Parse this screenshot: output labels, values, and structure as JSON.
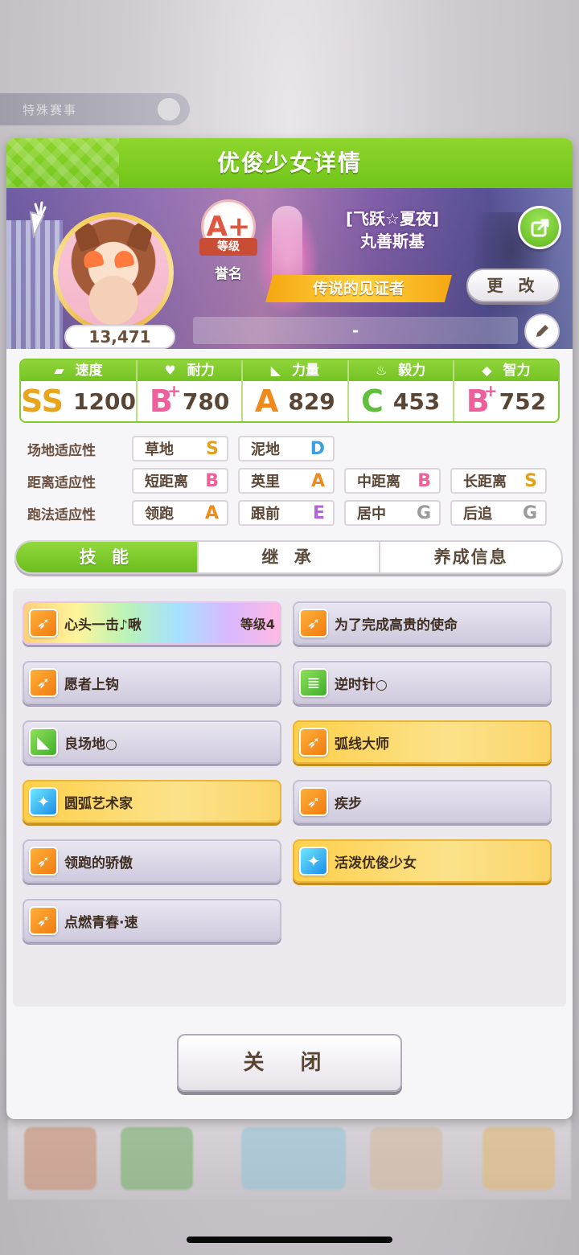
{
  "background": {
    "top_bar_label": "特殊赛事"
  },
  "modal": {
    "title": "优俊少女详情"
  },
  "profile": {
    "score": "13,471",
    "rank": "A+",
    "rank_level_label": "等级",
    "rank_name": "誉名",
    "title_line1": "[飞跃☆夏夜]",
    "title_line2": "丸善斯基",
    "legend_title": "传说的见证者",
    "change_label": "更 改",
    "comment": "-"
  },
  "stats": [
    {
      "label": "速度",
      "icon": "shoe-icon",
      "grade": "SS",
      "plus": "",
      "value": "1200",
      "color": "#e8a41a"
    },
    {
      "label": "耐力",
      "icon": "heart-icon",
      "grade": "B",
      "plus": "+",
      "value": "780",
      "color": "#ee5f9c"
    },
    {
      "label": "力量",
      "icon": "muscle-icon",
      "grade": "A",
      "plus": "",
      "value": "829",
      "color": "#f08a1c"
    },
    {
      "label": "毅力",
      "icon": "flame-icon",
      "grade": "C",
      "plus": "",
      "value": "453",
      "color": "#5fbf3a"
    },
    {
      "label": "智力",
      "icon": "graduation-cap-icon",
      "grade": "B",
      "plus": "+",
      "value": "752",
      "color": "#ee5f9c"
    }
  ],
  "aptitude": {
    "track": {
      "label": "场地适应性",
      "items": [
        {
          "name": "草地",
          "grade": "S",
          "color": "#e3a019"
        },
        {
          "name": "泥地",
          "grade": "D",
          "color": "#3aa0e0"
        }
      ]
    },
    "distance": {
      "label": "距离适应性",
      "items": [
        {
          "name": "短距离",
          "grade": "B",
          "color": "#ee5f9c"
        },
        {
          "name": "英里",
          "grade": "A",
          "color": "#f08a1c"
        },
        {
          "name": "中距离",
          "grade": "B",
          "color": "#ee5f9c"
        },
        {
          "name": "长距离",
          "grade": "S",
          "color": "#e3a019"
        }
      ]
    },
    "strategy": {
      "label": "跑法适应性",
      "items": [
        {
          "name": "领跑",
          "grade": "A",
          "color": "#f08a1c"
        },
        {
          "name": "跟前",
          "grade": "E",
          "color": "#b565d9"
        },
        {
          "name": "居中",
          "grade": "G",
          "color": "#9a9a9a"
        },
        {
          "name": "后追",
          "grade": "G",
          "color": "#9a9a9a"
        }
      ]
    }
  },
  "tabs": [
    "技 能",
    "继 承",
    "养成信息"
  ],
  "skills": [
    {
      "name": "心头一击♪啾",
      "level": "等级4",
      "style": "rainbow",
      "icon": "speed-runner-icon",
      "icon_color": "orange"
    },
    {
      "name": "为了完成高贵的使命",
      "level": "",
      "style": "normal",
      "icon": "speed-runner-icon",
      "icon_color": "orange"
    },
    {
      "name": "愿者上钩",
      "level": "",
      "style": "normal",
      "icon": "speed-runner-icon",
      "icon_color": "orange"
    },
    {
      "name": "逆时针○",
      "level": "",
      "style": "normal",
      "icon": "document-icon",
      "icon_color": "green"
    },
    {
      "name": "良场地○",
      "level": "",
      "style": "normal",
      "icon": "muscle-icon",
      "icon_color": "green"
    },
    {
      "name": "弧线大师",
      "level": "",
      "style": "gold",
      "icon": "speed-runner-icon",
      "icon_color": "orange"
    },
    {
      "name": "圆弧艺术家",
      "level": "",
      "style": "gold",
      "icon": "sparkle-icon",
      "icon_color": "blue"
    },
    {
      "name": "疾步",
      "level": "",
      "style": "normal",
      "icon": "speed-runner-icon",
      "icon_color": "orange"
    },
    {
      "name": "领跑的骄傲",
      "level": "",
      "style": "normal",
      "icon": "speed-runner-icon",
      "icon_color": "orange"
    },
    {
      "name": "活泼优俊少女",
      "level": "",
      "style": "gold",
      "icon": "sparkle-icon",
      "icon_color": "blue"
    },
    {
      "name": "点燃青春·速",
      "level": "",
      "style": "normal",
      "icon": "speed-runner-icon",
      "icon_color": "orange"
    }
  ],
  "close_label": "关 闭"
}
